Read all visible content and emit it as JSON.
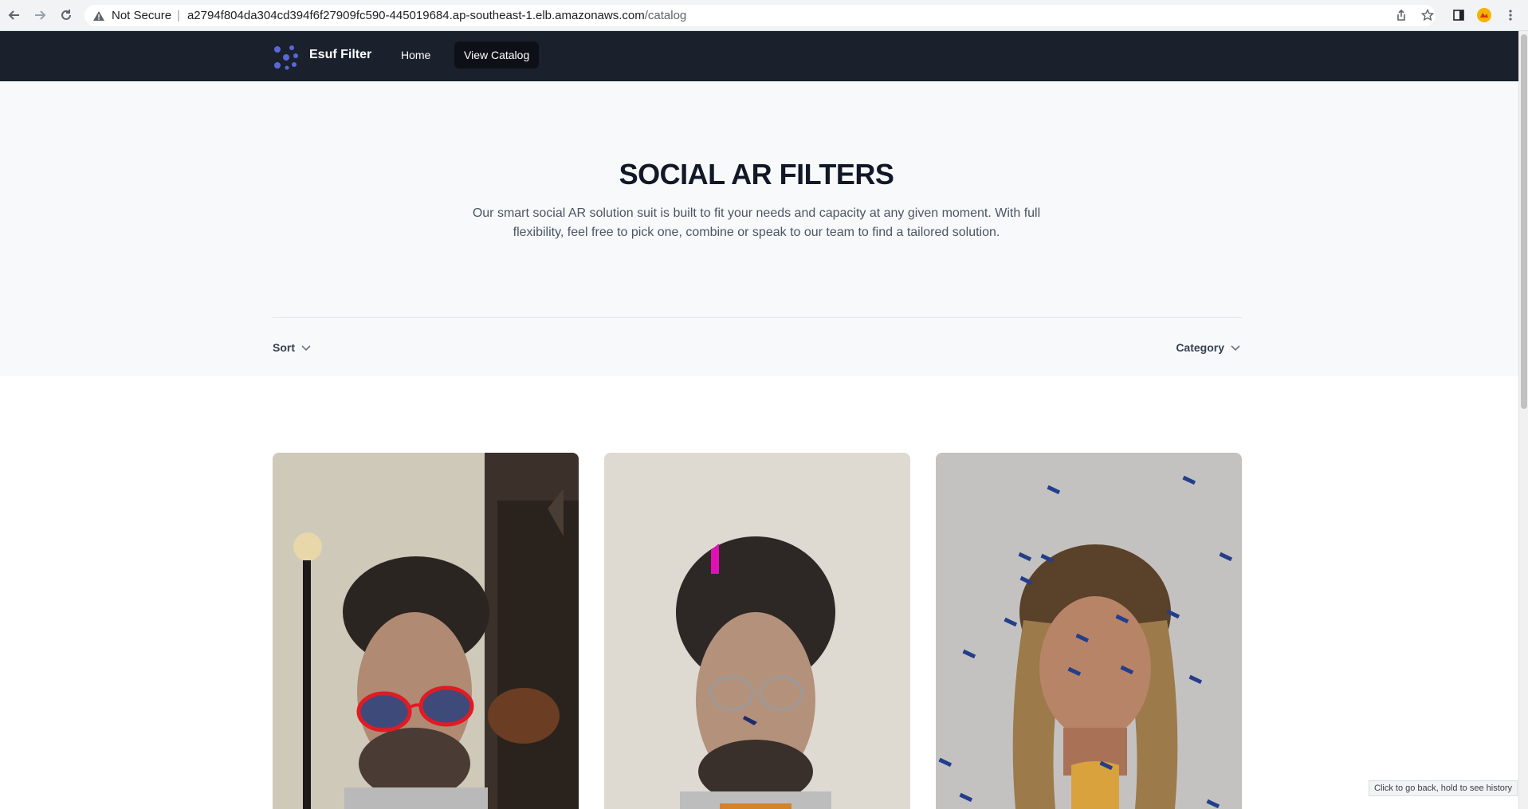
{
  "browser": {
    "security_label": "Not Secure",
    "url_host": "a2794f804da304cd394f6f27909fc590-445019684.ap-southeast-1.elb.amazonaws.com",
    "url_path": "/catalog",
    "tooltip": "Click to go back, hold to see history"
  },
  "nav": {
    "brand": "Esuf Filter",
    "home_label": "Home",
    "catalog_label": "View Catalog",
    "logo_color": "#5a67d8"
  },
  "hero": {
    "title": "SOCIAL AR FILTERS",
    "subtitle": "Our smart social AR solution suit is built to fit your needs and capacity at any given moment. With full flexibility, feel free to pick one, combine or speak to our team to find a tailored solution."
  },
  "filters": {
    "sort_label": "Sort",
    "category_label": "Category"
  },
  "products": [
    {
      "image": "man-with-red-sunglasses-filter"
    },
    {
      "image": "man-with-number-one-filter"
    },
    {
      "image": "woman-with-falling-pens-filter"
    }
  ]
}
